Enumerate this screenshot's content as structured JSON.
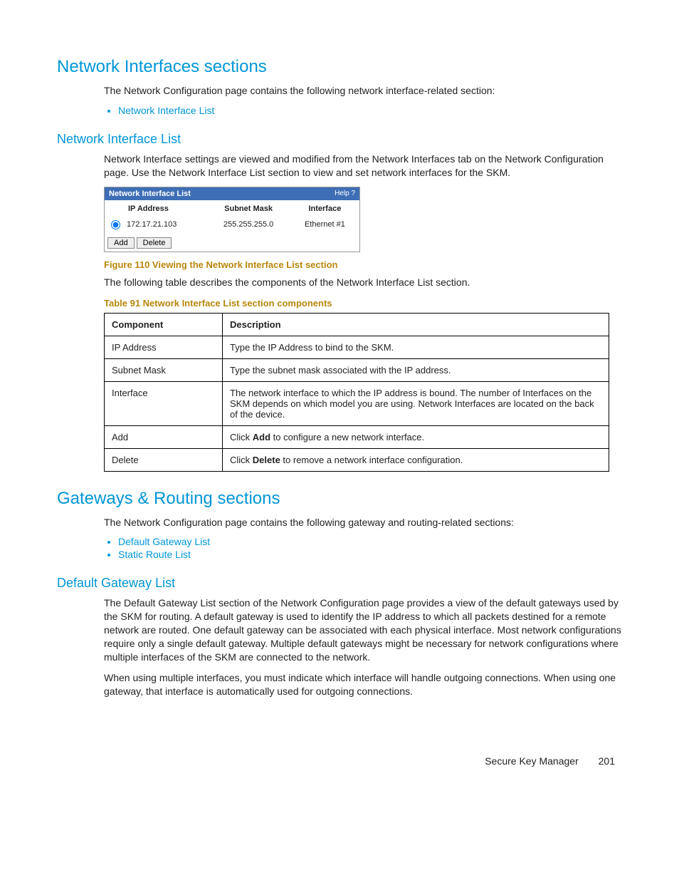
{
  "h1_1": "Network Interfaces sections",
  "p1": "The Network Configuration page contains the following network interface-related section:",
  "bullets1": [
    "Network Interface List"
  ],
  "h2_1": "Network Interface List",
  "p2": "Network Interface settings are viewed and modified from the Network Interfaces tab on the Network Configuration page. Use the Network Interface List section to view and set network interfaces for the SKM.",
  "panel": {
    "title": "Network Interface List",
    "help": "Help",
    "cols": [
      "IP Address",
      "Subnet Mask",
      "Interface"
    ],
    "row": {
      "ip": "172.17.21.103",
      "mask": "255.255.255.0",
      "iface": "Ethernet #1"
    },
    "btn_add": "Add",
    "btn_delete": "Delete"
  },
  "figcap": "Figure 110 Viewing the Network Interface List section",
  "p3": "The following table describes the components of the Network Interface List section.",
  "tabcap": "Table 91 Network Interface List section components",
  "table": {
    "head": [
      "Component",
      "Description"
    ],
    "rows": [
      {
        "c": "IP Address",
        "d_pre": "Type the IP Address to bind to the SKM.",
        "d_bold": "",
        "d_post": ""
      },
      {
        "c": "Subnet Mask",
        "d_pre": "Type the subnet mask associated with the IP address.",
        "d_bold": "",
        "d_post": ""
      },
      {
        "c": "Interface",
        "d_pre": "The network interface to which the IP address is bound. The number of Interfaces on the SKM depends on which model you are using. Network Interfaces are located on the back of the device.",
        "d_bold": "",
        "d_post": ""
      },
      {
        "c": "Add",
        "d_pre": "Click ",
        "d_bold": "Add",
        "d_post": " to configure a new network interface."
      },
      {
        "c": "Delete",
        "d_pre": "Click ",
        "d_bold": "Delete",
        "d_post": " to remove a network interface configuration."
      }
    ]
  },
  "h1_2": "Gateways & Routing sections",
  "p4": "The Network Configuration page contains the following gateway and routing-related sections:",
  "bullets2": [
    "Default Gateway List",
    "Static Route List"
  ],
  "h2_2": "Default Gateway List",
  "p5": "The Default Gateway List section of the Network Configuration page provides a view of the default gateways used by the SKM for routing. A default gateway is used to identify the IP address to which all packets destined for a remote network are routed. One default gateway can be associated with each physical interface. Most network configurations require only a single default gateway. Multiple default gateways might be necessary for network configurations where multiple interfaces of the SKM are connected to the network.",
  "p6": "When using multiple interfaces, you must indicate which interface will handle outgoing connections. When using one gateway, that interface is automatically used for outgoing connections.",
  "footer": {
    "label": "Secure Key Manager",
    "page": "201"
  }
}
